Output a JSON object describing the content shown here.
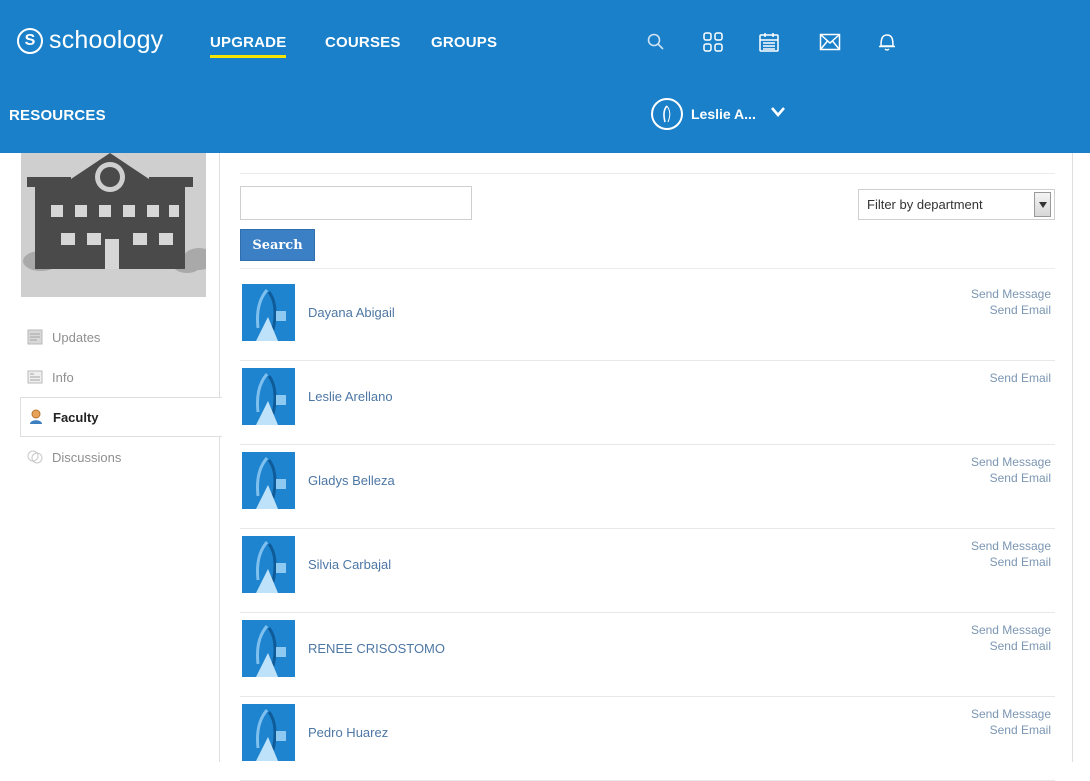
{
  "brand": {
    "mark": "S",
    "name": "schoology"
  },
  "nav": {
    "upgrade": "UPGRADE",
    "courses": "COURSES",
    "groups": "GROUPS",
    "resources": "RESOURCES"
  },
  "icons": [
    "search-icon",
    "apps-grid-icon",
    "calendar-icon",
    "mail-icon",
    "notifications-bell-icon"
  ],
  "user": {
    "name": "Leslie A..."
  },
  "sidebar": {
    "items": [
      {
        "label": "Updates",
        "icon": "updates-icon"
      },
      {
        "label": "Info",
        "icon": "info-icon"
      },
      {
        "label": "Faculty",
        "icon": "faculty-person-icon",
        "active": true
      },
      {
        "label": "Discussions",
        "icon": "discussions-icon"
      }
    ]
  },
  "search": {
    "placeholder": "",
    "value": "",
    "button": "Search"
  },
  "filter": {
    "selected": "Filter by department"
  },
  "faculty": [
    {
      "name": "Dayana Abigail",
      "send_message": "Send Message",
      "send_email": "Send Email"
    },
    {
      "name": "Leslie Arellano",
      "send_message": "",
      "send_email": "Send Email"
    },
    {
      "name": "Gladys Belleza",
      "send_message": "Send Message",
      "send_email": "Send Email"
    },
    {
      "name": "Silvia Carbajal",
      "send_message": "Send Message",
      "send_email": "Send Email"
    },
    {
      "name": "RENEE CRISOSTOMO",
      "send_message": "Send Message",
      "send_email": "Send Email"
    },
    {
      "name": "Pedro Huarez",
      "send_message": "Send Message",
      "send_email": "Send Email"
    }
  ],
  "colors": {
    "topbar": "#1a80c9",
    "accent_underline": "#f7e300",
    "link": "#4d77a4",
    "action": "#7b96b3",
    "button": "#3b7fc4"
  }
}
